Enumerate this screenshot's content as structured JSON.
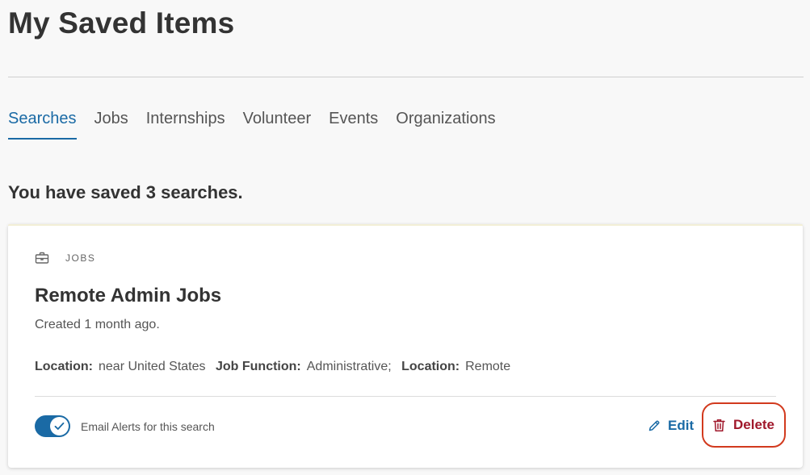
{
  "page": {
    "title": "My Saved Items"
  },
  "tabs": [
    {
      "label": "Searches",
      "active": true
    },
    {
      "label": "Jobs",
      "active": false
    },
    {
      "label": "Internships",
      "active": false
    },
    {
      "label": "Volunteer",
      "active": false
    },
    {
      "label": "Events",
      "active": false
    },
    {
      "label": "Organizations",
      "active": false
    }
  ],
  "summary": "You have saved 3 searches.",
  "saved_search": {
    "category_icon": "briefcase-icon",
    "category": "JOBS",
    "name": "Remote Admin Jobs",
    "created": "Created 1 month ago.",
    "criteria": [
      {
        "label": "Location:",
        "value": "near United States"
      },
      {
        "label": "Job Function:",
        "value": "Administrative;"
      },
      {
        "label": "Location:",
        "value": "Remote"
      }
    ],
    "email_alerts": {
      "enabled": true,
      "label": "Email Alerts for this search"
    },
    "actions": {
      "edit_label": "Edit",
      "edit_icon": "pencil-icon",
      "delete_label": "Delete",
      "delete_icon": "trash-icon"
    }
  },
  "colors": {
    "accent": "#1a6aa5",
    "delete_text": "#a0182b",
    "delete_highlight": "#d23a1e",
    "background": "#f8f8f8"
  }
}
